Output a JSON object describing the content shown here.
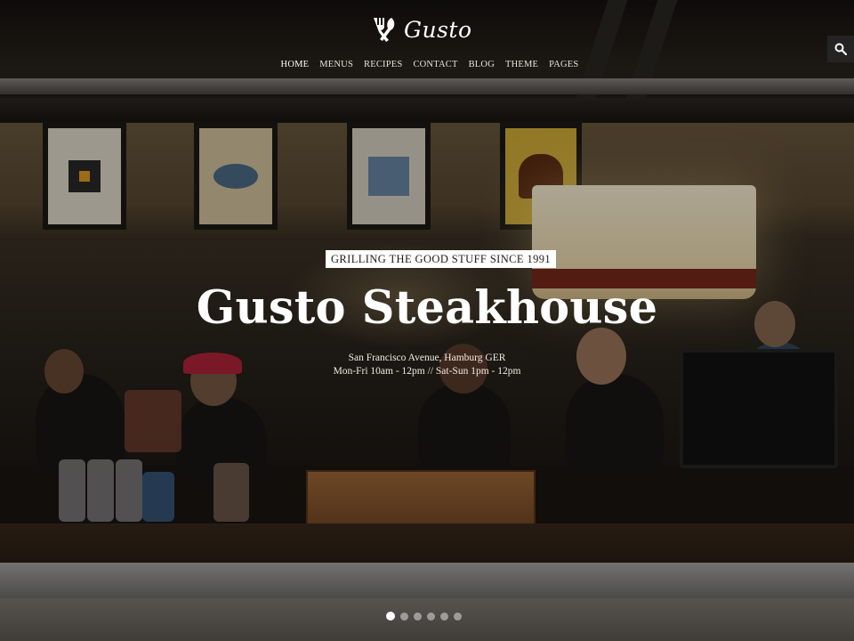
{
  "brand": {
    "name": "Gusto",
    "icon": "fork-knife-icon"
  },
  "nav": {
    "items": [
      {
        "label": "HOME",
        "active": true
      },
      {
        "label": "MENUS"
      },
      {
        "label": "RECIPES"
      },
      {
        "label": "CONTACT"
      },
      {
        "label": "BLOG"
      },
      {
        "label": "THEME"
      },
      {
        "label": "PAGES"
      }
    ],
    "search_icon": "search-icon"
  },
  "hero": {
    "tagline": "GRILLING THE GOOD STUFF SINCE 1991",
    "title": "Gusto Steakhouse",
    "address": "San Francisco Avenue, Hamburg GER",
    "hours": "Mon-Fri 10am - 12pm // Sat-Sun 1pm - 12pm"
  },
  "slider": {
    "slide_count": 6,
    "active_index": 0
  },
  "colors": {
    "text": "#ffffff",
    "tagline_bg": "#ffffff",
    "tagline_text": "#1f1a15"
  }
}
